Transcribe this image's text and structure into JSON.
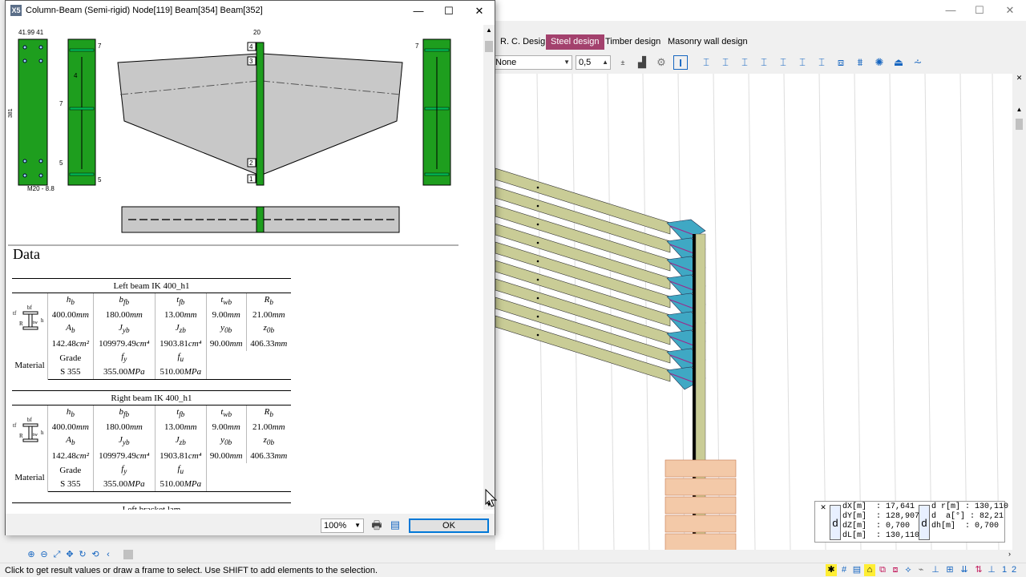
{
  "dialog": {
    "logo": "X5",
    "title": "Column-Beam (Semi-rigid) Node[119] Beam[354]  Beam[352]",
    "data_heading": "Data",
    "zoom": "100%",
    "ok_label": "OK",
    "drawing": {
      "left_dim_top": "41.99 41",
      "left_dim_side": "381",
      "left_bolt_label": "M20 - 8.8",
      "weld_labels": [
        "7",
        "4",
        "7",
        "5",
        "5",
        "7"
      ],
      "column_dim": "20",
      "node_numbers": [
        "4",
        "3",
        "2",
        "1"
      ]
    },
    "left_beam": {
      "caption": "Left beam IK 400_h1",
      "row1_symbols": [
        "h",
        "b",
        "t",
        "t",
        "R"
      ],
      "row1_subs": [
        "b",
        "fb",
        "fb",
        "wb",
        "b"
      ],
      "row1_values": [
        "400.00",
        "180.00",
        "13.00",
        "9.00",
        "21.00"
      ],
      "row1_units": [
        "mm",
        "mm",
        "mm",
        "mm",
        "mm"
      ],
      "row2_symbols": [
        "A",
        "J",
        "J",
        "y",
        "z"
      ],
      "row2_subs": [
        "b",
        "yb",
        "zb",
        "0b",
        "0b"
      ],
      "row2_values": [
        "142.48",
        "109979.49",
        "1903.81",
        "90.00",
        "406.33"
      ],
      "row2_units": [
        "cm²",
        "cm⁴",
        "cm⁴",
        "mm",
        "mm"
      ],
      "material_label": "Material",
      "grade_label": "Grade",
      "fy_symbol": "f",
      "fy_sub": "y",
      "fu_symbol": "f",
      "fu_sub": "u",
      "grade": "S 355",
      "fy": "355.00",
      "fy_unit": "MPa",
      "fu": "510.00",
      "fu_unit": "MPa"
    },
    "right_beam": {
      "caption": "Right beam IK 400_h1",
      "row1_symbols": [
        "h",
        "b",
        "t",
        "t",
        "R"
      ],
      "row1_subs": [
        "b",
        "fb",
        "fb",
        "wb",
        "b"
      ],
      "row1_values": [
        "400.00",
        "180.00",
        "13.00",
        "9.00",
        "21.00"
      ],
      "row1_units": [
        "mm",
        "mm",
        "mm",
        "mm",
        "mm"
      ],
      "row2_symbols": [
        "A",
        "J",
        "J",
        "y",
        "z"
      ],
      "row2_subs": [
        "b",
        "yb",
        "zb",
        "0b",
        "0b"
      ],
      "row2_values": [
        "142.48",
        "109979.49",
        "1903.81",
        "90.00",
        "406.33"
      ],
      "row2_units": [
        "cm²",
        "cm⁴",
        "cm⁴",
        "mm",
        "mm"
      ],
      "material_label": "Material",
      "grade_label": "Grade",
      "fy_symbol": "f",
      "fy_sub": "y",
      "fu_symbol": "f",
      "fu_sub": "u",
      "grade": "S 355",
      "fy": "355.00",
      "fy_unit": "MPa",
      "fu": "510.00",
      "fu_unit": "MPa"
    },
    "section_icon_labels": {
      "top": "bf",
      "left": "tf",
      "right": "h",
      "web": "tw",
      "root": "R"
    },
    "next_section_caption": "Left bracket lam"
  },
  "main": {
    "tabs": [
      "R. C. Design",
      "Steel design",
      "Timber design",
      "Masonry wall design"
    ],
    "active_tab": "Steel design",
    "combo_none": "None",
    "combo_ratio": "0,5",
    "coords": {
      "close": "✕",
      "d_label": "d",
      "left": [
        "dX[m]  : 17,641",
        "dY[m]  : 128,907",
        "dZ[m]  : 0,700",
        "dL[m]  : 130,110"
      ],
      "right": [
        "d r[m] : 130,110",
        "d  a[°] : 82,21",
        "dh[m]  : 0,700"
      ]
    },
    "status": "Click to get result values or draw a frame to select. Use SHIFT to add elements to the selection."
  },
  "colors": {
    "accent_tab": "#a3416d",
    "steel_green": "#1e9e1e",
    "beam_fill": "#c9cc96",
    "haunch_fill": "#3fa8c4",
    "footing_fill": "#f3c9a8"
  }
}
